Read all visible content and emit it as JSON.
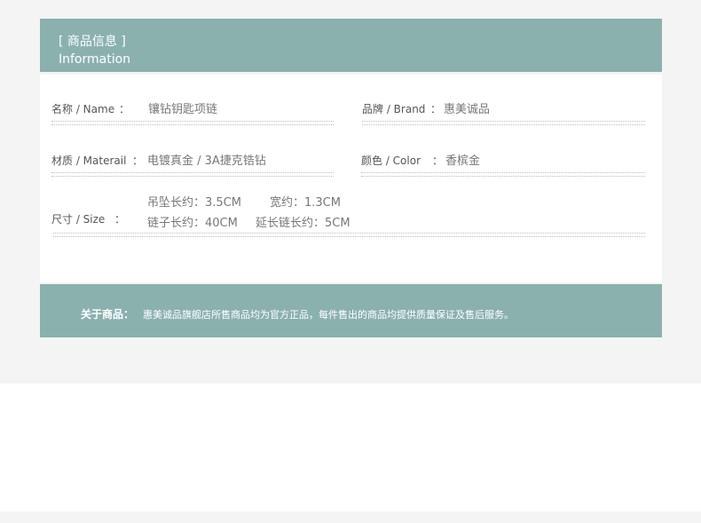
{
  "header": {
    "title_cn": "[ 商品信息 ]",
    "title_en": "Information"
  },
  "rows": {
    "name": {
      "label": "名称 / Name",
      "colon": "：",
      "value": "镶钻钥匙项链"
    },
    "brand": {
      "label": "品牌 / Brand",
      "colon": "：",
      "value": "惠美诚品"
    },
    "material": {
      "label": "材质 / Materail",
      "colon": "：",
      "value": "电镀真金 / 3A捷克锆钻"
    },
    "color": {
      "label": "颜色 / Color",
      "colon": "：",
      "value": "香槟金"
    },
    "size": {
      "label": "尺寸 / Size",
      "colon": "：",
      "pendant_length": "吊坠长约：3.5CM",
      "width": "宽约：1.3CM",
      "chain_length": "链子长约：40CM",
      "extension_length": "延长链长约：5CM"
    }
  },
  "footer": {
    "label": "关于商品：",
    "text": "惠美诚品旗舰店所售商品均为官方正品，每件售出的商品均提供质量保证及售后服务。"
  }
}
